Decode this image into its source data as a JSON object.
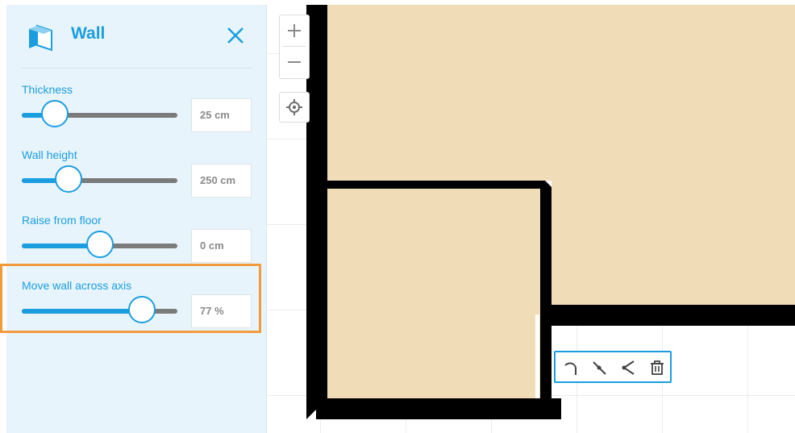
{
  "panel": {
    "title": "Wall",
    "controls": [
      {
        "label": "Thickness",
        "value_text": "25 cm",
        "level_percent": 21
      },
      {
        "label": "Wall height",
        "value_text": "250 cm",
        "level_percent": 30
      },
      {
        "label": "Raise from floor",
        "value_text": "0 cm",
        "level_percent": 50
      },
      {
        "label": "Move wall across axis",
        "value_text": "77 %",
        "level_percent": 77
      }
    ]
  },
  "icons": {
    "wall": "wall-icon",
    "close": "close-icon",
    "zoom_in": "plus-icon",
    "zoom_out": "minus-icon",
    "locate": "crosshair-icon",
    "curve": "curve-wall-icon",
    "split": "split-wall-icon",
    "angle": "angle-wall-icon",
    "delete": "trash-icon"
  },
  "colors": {
    "accent": "#1a9ee0",
    "highlight": "#f39a3d",
    "floor": "#f1dcb8",
    "wall": "#000000"
  }
}
